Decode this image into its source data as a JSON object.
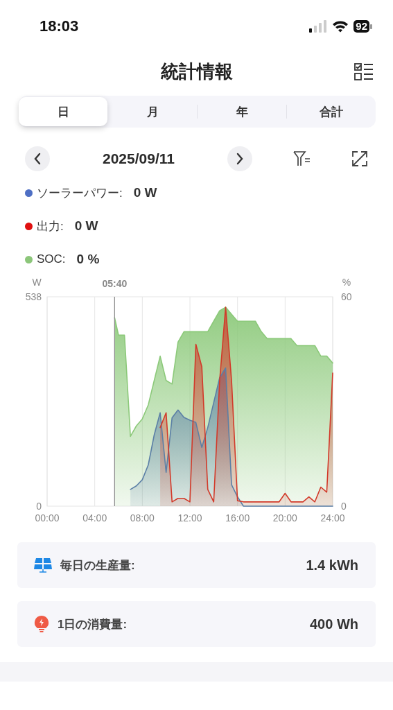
{
  "status_bar": {
    "time": "18:03",
    "battery": "92"
  },
  "header": {
    "title": "統計情報"
  },
  "tabs": [
    {
      "label": "日",
      "selected": true
    },
    {
      "label": "月",
      "selected": false
    },
    {
      "label": "年",
      "selected": false
    },
    {
      "label": "合計",
      "selected": false
    }
  ],
  "date_nav": {
    "date": "2025/09/11"
  },
  "legend": [
    {
      "value": "0 W",
      "color": "#4e6fc4"
    },
    {
      "value": "0 W",
      "color": "#e01010"
    },
    {
      "value": "0 %",
      "color": "#8cc67a"
    }
  ],
  "chart_data": {
    "type": "area",
    "ylabel": "W",
    "y2label": "%",
    "xlim": [
      0,
      24
    ],
    "ylim": [
      0,
      538
    ],
    "y2lim": [
      0,
      60
    ],
    "yticks": [
      0,
      538
    ],
    "y2ticks": [
      0,
      60
    ],
    "xticks": [
      {
        "value": 0,
        "label": "00:00"
      },
      {
        "value": 4,
        "label": "04:00"
      },
      {
        "value": 8,
        "label": "08:00"
      },
      {
        "value": 12,
        "label": "12:00"
      },
      {
        "value": 16,
        "label": "16:00"
      },
      {
        "value": 20,
        "label": "20:00"
      },
      {
        "value": 24,
        "label": "24:00"
      }
    ],
    "grid": true,
    "annotations": [
      {
        "x": 5.67,
        "text": "05:40"
      }
    ],
    "x": [
      5.67,
      6,
      6.5,
      7,
      7.5,
      8,
      8.5,
      9,
      9.5,
      10,
      10.5,
      11,
      11.5,
      12,
      12.5,
      13,
      13.5,
      14,
      14.5,
      15,
      15.5,
      16,
      16.5,
      17,
      17.5,
      18,
      18.5,
      19,
      19.5,
      20,
      20.5,
      21,
      21.5,
      22,
      22.5,
      23,
      23.5,
      24
    ],
    "series": [
      {
        "name": "ソーラーパワー:",
        "color": "#5b7fa6",
        "values": [
          null,
          null,
          null,
          43,
          52,
          68,
          106,
          183,
          240,
          87,
          227,
          247,
          228,
          221,
          215,
          151,
          202,
          266,
          330,
          355,
          55,
          24,
          0,
          0,
          0,
          0,
          0,
          0,
          0,
          0,
          0,
          0,
          0,
          0,
          0,
          0,
          0,
          0
        ]
      },
      {
        "name": "出力:",
        "color": "#d23a2a",
        "values": [
          null,
          null,
          null,
          null,
          null,
          null,
          null,
          null,
          202,
          240,
          11,
          20,
          20,
          11,
          416,
          358,
          43,
          11,
          323,
          511,
          323,
          14,
          11,
          11,
          11,
          11,
          11,
          11,
          11,
          33,
          11,
          11,
          11,
          24,
          11,
          49,
          36,
          342
        ]
      },
      {
        "name": "SOC:",
        "color": "#8cc97a",
        "axis": "y2",
        "values": [
          54,
          49,
          49,
          20,
          23,
          25,
          29,
          36,
          43,
          36,
          35,
          47,
          50,
          50,
          50,
          50,
          50,
          53,
          56,
          57,
          55,
          53,
          53,
          53,
          53,
          50,
          48,
          48,
          48,
          48,
          48,
          46,
          46,
          46,
          46,
          43,
          43,
          41
        ]
      }
    ]
  },
  "stats": [
    {
      "kind": "solar",
      "label": "毎日の生産量:",
      "value": "1.4 kWh"
    },
    {
      "kind": "bulb",
      "label": "1日の消費量:",
      "value": "400 Wh"
    }
  ]
}
